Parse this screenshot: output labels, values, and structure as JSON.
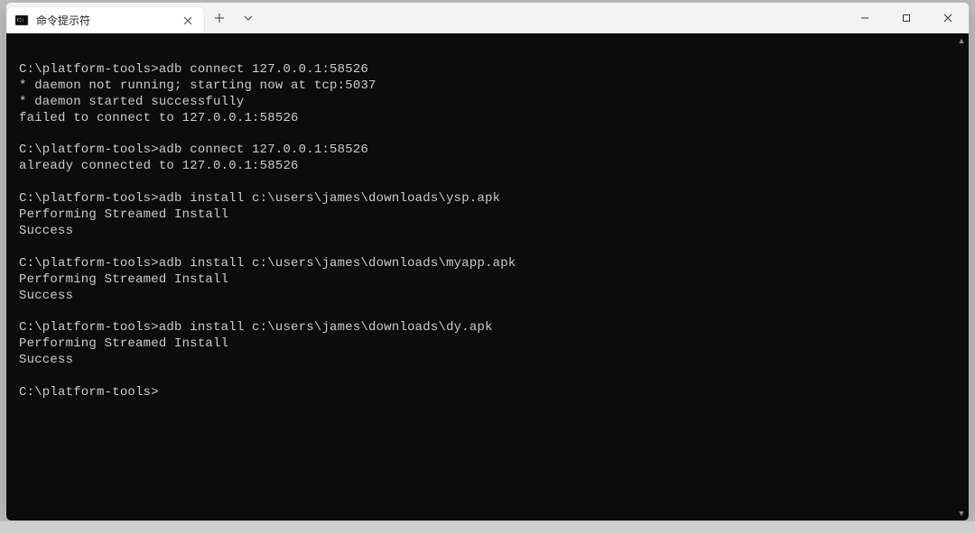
{
  "titlebar": {
    "tab_title": "命令提示符"
  },
  "terminal": {
    "lines": [
      "",
      "C:\\platform-tools>adb connect 127.0.0.1:58526",
      "* daemon not running; starting now at tcp:5037",
      "* daemon started successfully",
      "failed to connect to 127.0.0.1:58526",
      "",
      "C:\\platform-tools>adb connect 127.0.0.1:58526",
      "already connected to 127.0.0.1:58526",
      "",
      "C:\\platform-tools>adb install c:\\users\\james\\downloads\\ysp.apk",
      "Performing Streamed Install",
      "Success",
      "",
      "C:\\platform-tools>adb install c:\\users\\james\\downloads\\myapp.apk",
      "Performing Streamed Install",
      "Success",
      "",
      "C:\\platform-tools>adb install c:\\users\\james\\downloads\\dy.apk",
      "Performing Streamed Install",
      "Success",
      "",
      "C:\\platform-tools>"
    ]
  }
}
